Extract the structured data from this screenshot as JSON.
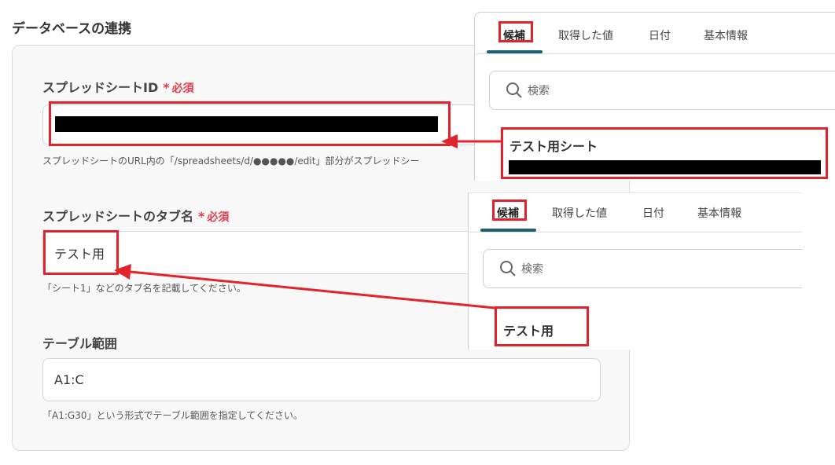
{
  "section": {
    "title": "データベースの連携"
  },
  "form": {
    "spreadsheet_id": {
      "label": "スプレッドシートID",
      "required": "必須",
      "help": "スプレッドシートのURL内の「/spreadsheets/d/●●●●●/edit」部分がスプレッドシー"
    },
    "tab_name": {
      "label": "スプレッドシートのタブ名",
      "required": "必須",
      "value": "テスト用",
      "help": "「シート1」などのタブ名を記載してください。"
    },
    "table_range": {
      "label": "テーブル範囲",
      "value": "A1:C",
      "help": "「A1:G30」という形式でテーブル範囲を指定してください。"
    }
  },
  "panel_top": {
    "tabs": [
      "候補",
      "取得した値",
      "日付",
      "基本情報"
    ],
    "search_placeholder": "検索",
    "candidate_title": "テスト用シート"
  },
  "panel_bottom": {
    "tabs": [
      "候補",
      "取得した値",
      "日付",
      "基本情報"
    ],
    "search_placeholder": "検索",
    "candidate_title": "テスト用"
  },
  "colors": {
    "highlight": "#e3232c",
    "required": "#e43c4a",
    "tab_underline": "#1f5f6e"
  },
  "icons": {
    "search": "search-icon",
    "arrow": "arrow-annotation"
  }
}
